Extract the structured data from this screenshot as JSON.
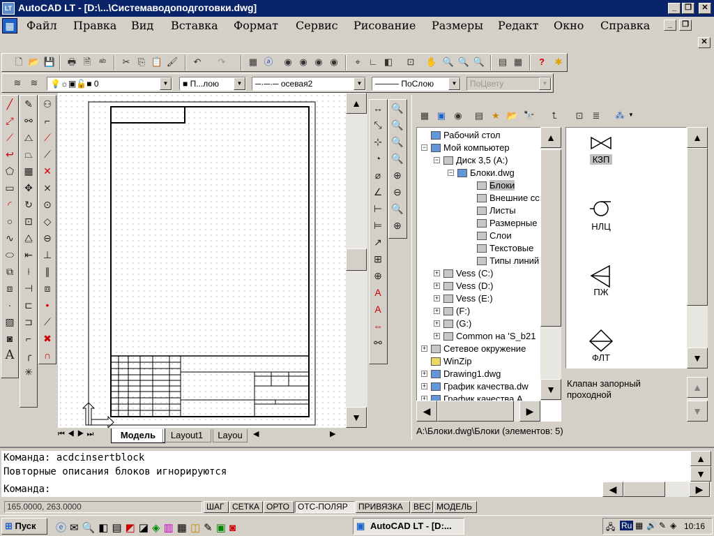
{
  "window": {
    "title": "AutoCAD LT - [D:\\...\\Системаводоподготовки.dwg]",
    "app_icon": "LT"
  },
  "menu": [
    "Файл",
    "Правка",
    "Вид",
    "Вставка",
    "Формат",
    "Сервис",
    "Рисование",
    "Размеры",
    "Редакт",
    "Окно",
    "Справка"
  ],
  "layers_toolbar": {
    "layer_value": "0",
    "color_value": "П...лою",
    "linetype_value": "осевая2",
    "lineweight_value": "ПоСлою",
    "plotstyle_value": "ПоЦвету"
  },
  "tabs": {
    "model": "Модель",
    "layout1": "Layout1",
    "layout2": "Layou"
  },
  "design_center": {
    "tree": [
      {
        "label": "Рабочий стол",
        "icon": "desktop-icon"
      },
      {
        "label": "Мой компьютер",
        "icon": "computer-icon"
      },
      {
        "label": "Диск 3,5 (A:)",
        "icon": "floppy-icon"
      },
      {
        "label": "Блоки.dwg",
        "icon": "dwg-icon"
      },
      {
        "label": "Блоки",
        "icon": "blocks-icon"
      },
      {
        "label": "Внешние сс",
        "icon": "xref-icon"
      },
      {
        "label": "Листы",
        "icon": "layouts-icon"
      },
      {
        "label": "Размерные",
        "icon": "dimstyles-icon"
      },
      {
        "label": "Слои",
        "icon": "layers-icon"
      },
      {
        "label": "Текстовые",
        "icon": "textstyles-icon"
      },
      {
        "label": "Типы линий",
        "icon": "linetypes-icon"
      },
      {
        "label": "Vess (C:)",
        "icon": "drive-icon"
      },
      {
        "label": "Vess (D:)",
        "icon": "drive-icon"
      },
      {
        "label": "Vess (E:)",
        "icon": "drive-icon"
      },
      {
        "label": "(F:)",
        "icon": "cdrom-icon"
      },
      {
        "label": "(G:)",
        "icon": "cdrom-icon"
      },
      {
        "label": "Common на 'S_b21",
        "icon": "network-drive-icon"
      },
      {
        "label": "Сетевое окружение",
        "icon": "network-icon"
      },
      {
        "label": "WinZip",
        "icon": "folder-icon"
      },
      {
        "label": "Drawing1.dwg",
        "icon": "dwg-icon"
      },
      {
        "label": "График качества.dw",
        "icon": "dwg-icon"
      },
      {
        "label": "График качества А",
        "icon": "dwg-icon"
      }
    ],
    "blocks": [
      {
        "label": "КЗП",
        "icon": "valve-icon"
      },
      {
        "label": "НЛЦ",
        "icon": "pump-icon"
      },
      {
        "label": "ПЖ",
        "icon": "nozzle-icon"
      },
      {
        "label": "ФЛТ",
        "icon": "filter-icon"
      }
    ],
    "description": "Клапан запорный проходной",
    "status": "A:\\Блоки.dwg\\Блоки (элементов: 5)"
  },
  "command": {
    "line1": "Команда: acdcinsertblock",
    "line2": "Повторные описания блоков игнорируются",
    "prompt": "Команда:"
  },
  "status_bar": {
    "coords": "165.0000, 263.0000",
    "buttons": [
      "ШАГ",
      "СЕТКА",
      "ОРТО",
      "ОТС-ПОЛЯР",
      "ПРИВЯЗКА",
      "ВЕС",
      "МОДЕЛЬ"
    ]
  },
  "taskbar": {
    "start": "Пуск",
    "task": "AutoCAD LT - [D:...",
    "lang": "Ru",
    "clock": "10:16"
  }
}
